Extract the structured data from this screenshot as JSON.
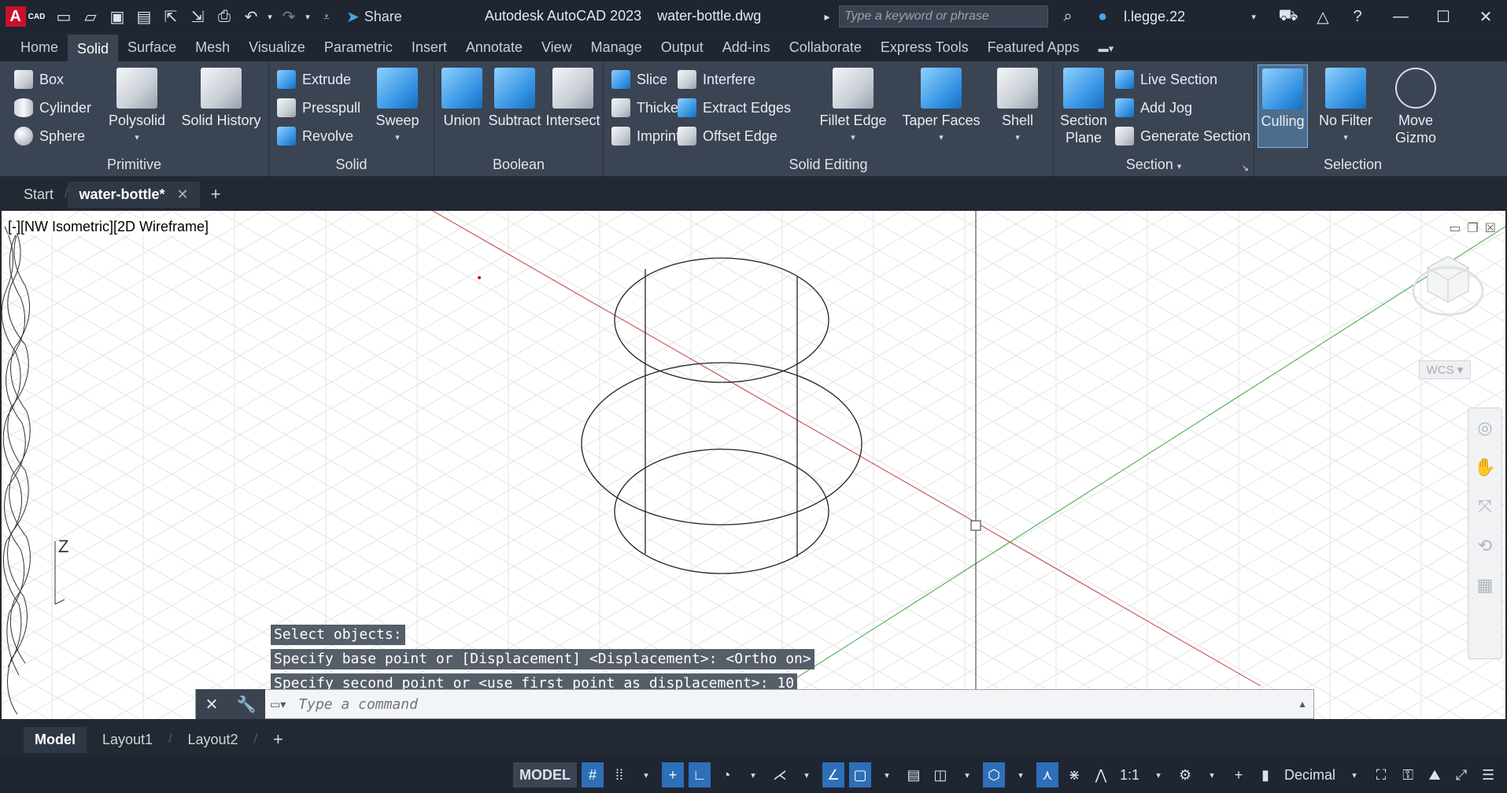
{
  "app": {
    "logo_letter": "A",
    "logo_sub": "CAD",
    "share_label": "Share",
    "title": "Autodesk AutoCAD 2023",
    "filename": "water-bottle.dwg",
    "search_placeholder": "Type a keyword or phrase",
    "user": "l.legge.22"
  },
  "ribbon_tabs": [
    "Home",
    "Solid",
    "Surface",
    "Mesh",
    "Visualize",
    "Parametric",
    "Insert",
    "Annotate",
    "View",
    "Manage",
    "Output",
    "Add-ins",
    "Collaborate",
    "Express Tools",
    "Featured Apps"
  ],
  "active_ribbon_tab": "Solid",
  "panels": {
    "primitive": {
      "title": "Primitive",
      "box": "Box",
      "cylinder": "Cylinder",
      "sphere": "Sphere",
      "polysolid": "Polysolid",
      "solid_history": "Solid History"
    },
    "solid": {
      "title": "Solid",
      "extrude": "Extrude",
      "presspull": "Presspull",
      "revolve": "Revolve",
      "sweep": "Sweep"
    },
    "boolean": {
      "title": "Boolean",
      "union": "Union",
      "subtract": "Subtract",
      "intersect": "Intersect"
    },
    "solid_editing": {
      "title": "Solid Editing",
      "slice": "Slice",
      "thicken": "Thicken",
      "imprint": "Imprint",
      "interfere": "Interfere",
      "extract_edges": "Extract Edges",
      "offset_edge": "Offset Edge",
      "fillet_edge": "Fillet Edge",
      "taper_faces": "Taper Faces",
      "shell": "Shell"
    },
    "section": {
      "title": "Section",
      "section_plane_1": "Section",
      "section_plane_2": "Plane",
      "live_section": "Live Section",
      "add_jog": "Add Jog",
      "generate_section": "Generate Section"
    },
    "selection": {
      "title": "Selection",
      "culling": "Culling",
      "no_filter": "No Filter",
      "move_gizmo_1": "Move",
      "move_gizmo_2": "Gizmo"
    }
  },
  "doc_tabs": {
    "start": "Start",
    "active": "water-bottle*"
  },
  "viewport": {
    "label": "[-][NW Isometric][2D Wireframe]",
    "wcs": "WCS",
    "z_axis": "Z"
  },
  "command_history": [
    "Select objects:",
    "Specify base point or [Displacement] <Displacement>:  <Ortho on>",
    "Specify second point or <use first point as displacement>: 10"
  ],
  "command_placeholder": "Type a command",
  "layout_tabs": [
    "Model",
    "Layout1",
    "Layout2"
  ],
  "status": {
    "model": "MODEL",
    "scale": "1:1",
    "units": "Decimal"
  }
}
